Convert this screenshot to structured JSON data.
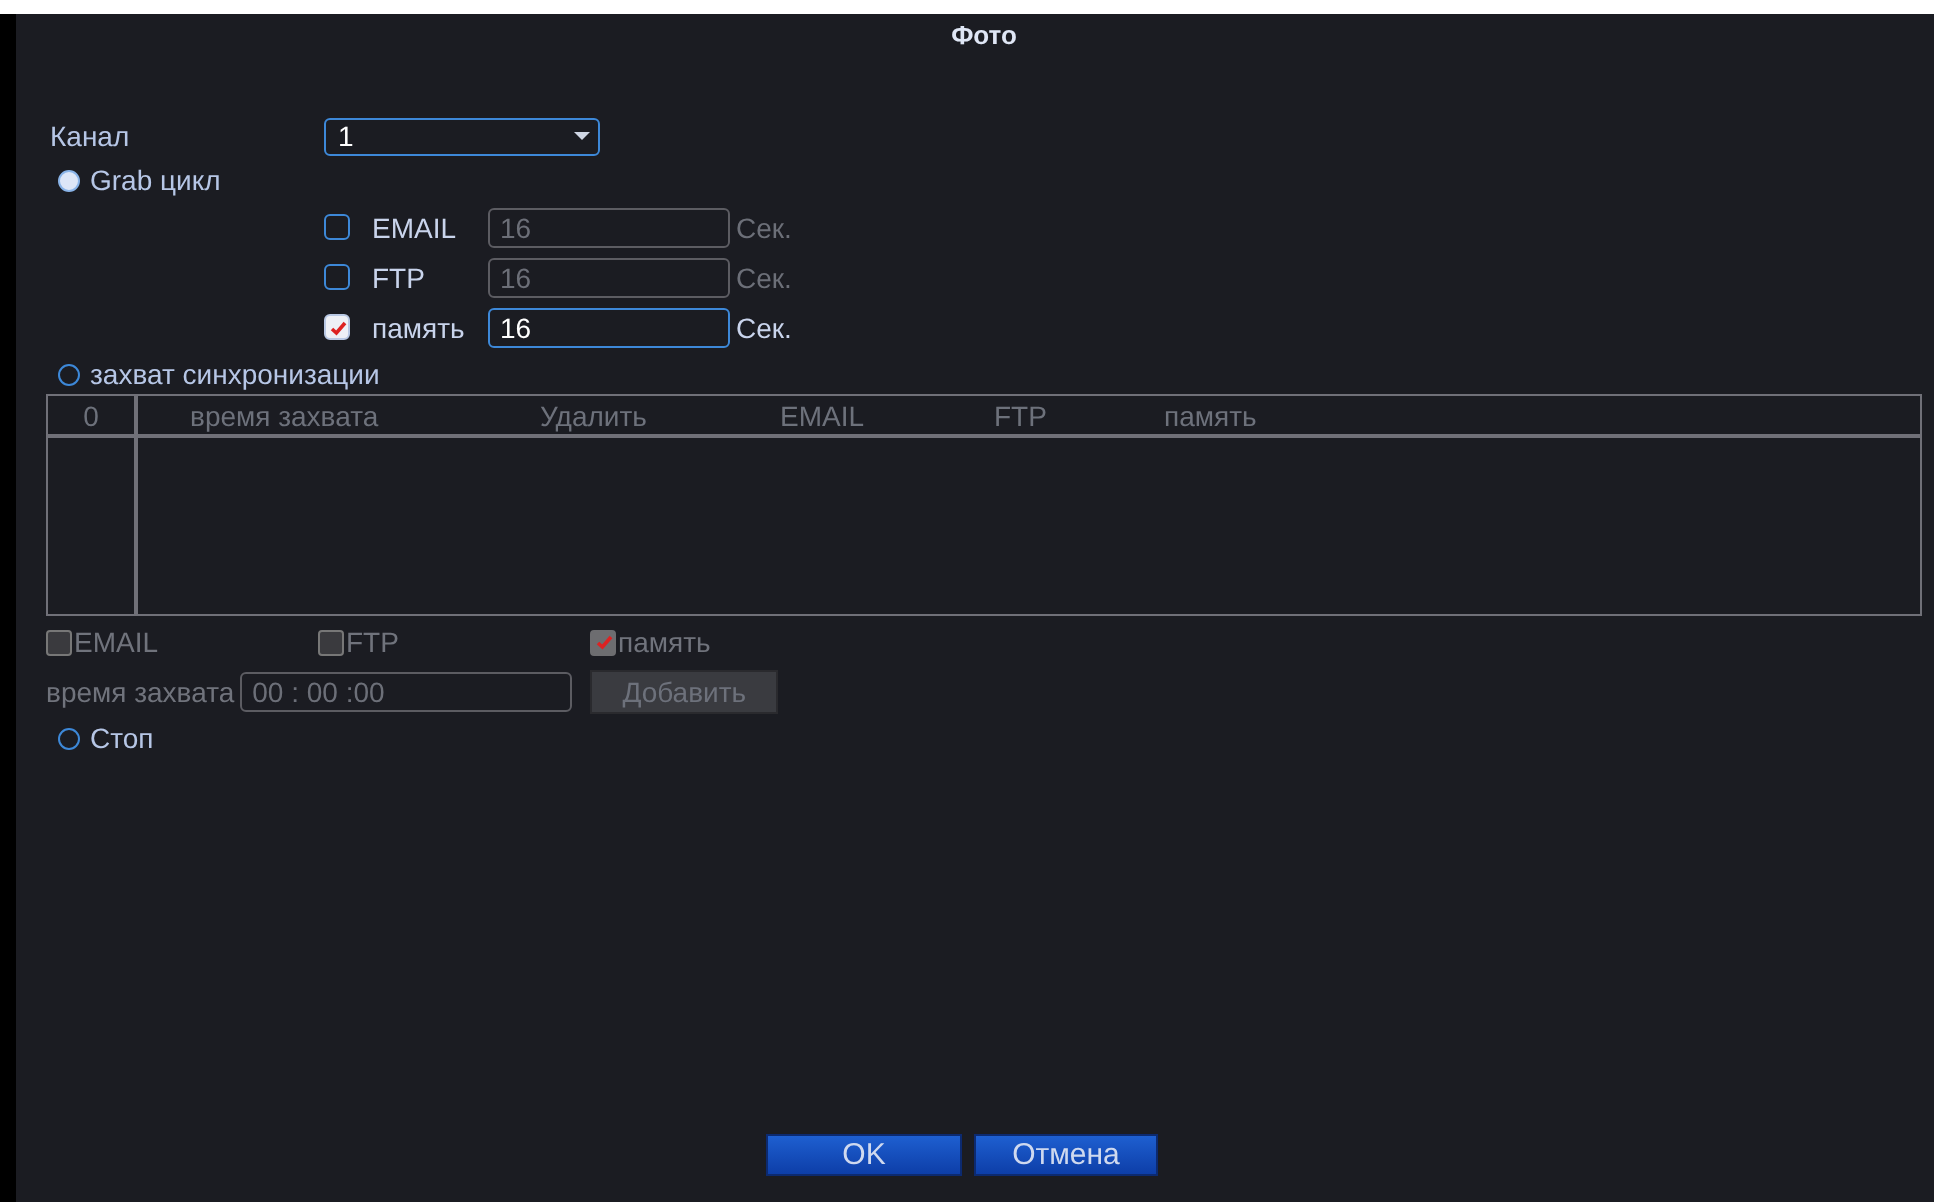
{
  "window": {
    "title": "Фото"
  },
  "channel": {
    "label": "Канал",
    "value": "1"
  },
  "grab_cycle": {
    "label": "Grab цикл",
    "selected": true,
    "options": [
      {
        "label": "EMAIL",
        "checked": false,
        "disabled": true,
        "value": "16",
        "unit": "Сек."
      },
      {
        "label": "FTP",
        "checked": false,
        "disabled": true,
        "value": "16",
        "unit": "Сек."
      },
      {
        "label": "память",
        "checked": true,
        "disabled": false,
        "value": "16",
        "unit": "Сек."
      }
    ]
  },
  "sync_capture": {
    "label": "захват синхронизации",
    "selected": false,
    "disabled": true,
    "table": {
      "columns": [
        "0",
        "время захвата",
        "Удалить",
        "EMAIL",
        "FTP",
        "память"
      ]
    },
    "options": [
      {
        "label": "EMAIL",
        "checked": false
      },
      {
        "label": "FTP",
        "checked": false
      },
      {
        "label": "память",
        "checked": true
      }
    ],
    "time_label": "время захвата",
    "time_value": "00 : 00 :00",
    "add_button": "Добавить"
  },
  "stop": {
    "label": "Стоп",
    "selected": false
  },
  "buttons": [
    "OK",
    "Отмена"
  ]
}
